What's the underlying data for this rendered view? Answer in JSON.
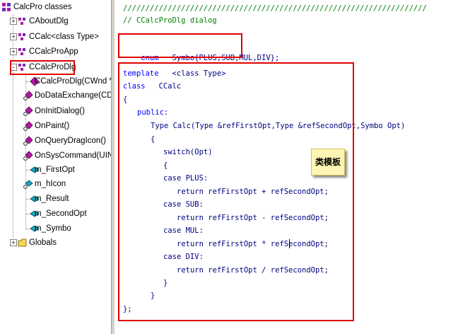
{
  "tree": {
    "root_label": "CalcPro classes",
    "classes": [
      {
        "label": "CAboutDlg",
        "expander": "+"
      },
      {
        "label": "CCalc<class Type>",
        "expander": "+"
      },
      {
        "label": "CCalcProApp",
        "expander": "+"
      },
      {
        "label": "CCalcProDlg",
        "expander": "-"
      }
    ],
    "members": [
      {
        "label": "CCalcProDlg(CWnd *pParen",
        "icon": "method-icon"
      },
      {
        "label": "DoDataExchange(CDataExc",
        "icon": "protected-method-icon"
      },
      {
        "label": "OnInitDialog()",
        "icon": "protected-method-icon"
      },
      {
        "label": "OnPaint()",
        "icon": "protected-method-icon"
      },
      {
        "label": "OnQueryDragIcon()",
        "icon": "protected-method-icon"
      },
      {
        "label": "OnSysCommand(UINT nID,",
        "icon": "protected-method-icon"
      },
      {
        "label": "m_FirstOpt",
        "icon": "member-variable-icon"
      },
      {
        "label": "m_hIcon",
        "icon": "protected-variable-icon"
      },
      {
        "label": "m_Result",
        "icon": "member-variable-icon"
      },
      {
        "label": "m_SecondOpt",
        "icon": "member-variable-icon"
      },
      {
        "label": "m_Symbo",
        "icon": "member-variable-icon"
      }
    ],
    "globals_label": "Globals",
    "globals_expander": "+"
  },
  "code": {
    "separator": "////////////////////////////////////////////////////////////////////",
    "dialog_comment": "// CCalcProDlg dialog",
    "enum_keyword": "enum",
    "enum_body": "Symbo{PLUS,SUB,MUL,DIV};",
    "l1_kw": "template",
    "l1_rest": "<class Type>",
    "l2_kw": "class",
    "l2_rest": "CCalc",
    "l3": "{",
    "l4": "public:",
    "l5": "Type Calc(Type &refFirstOpt,Type &refSecondOpt,Symbo Opt)",
    "l6": "{",
    "l7": "switch(Opt)",
    "l8": "{",
    "l9": "case PLUS:",
    "l10": "return refFirstOpt + refSecondOpt;",
    "l11": "case SUB:",
    "l12": "return refFirstOpt - refSecondOpt;",
    "l13": "case MUL:",
    "l14": "return refFirstOpt * refSecondOpt;",
    "l15": "case DIV:",
    "l16": "return refFirstOpt / refSecondOpt;",
    "l17": "}",
    "l18": "}",
    "l19": "};"
  },
  "annotation": {
    "label": "类模板"
  },
  "colors": {
    "highlight": "#e00000",
    "keyword": "#0000ff",
    "comment": "#008000",
    "code_text": "#000080",
    "note_bg": "#fdf5b3"
  }
}
